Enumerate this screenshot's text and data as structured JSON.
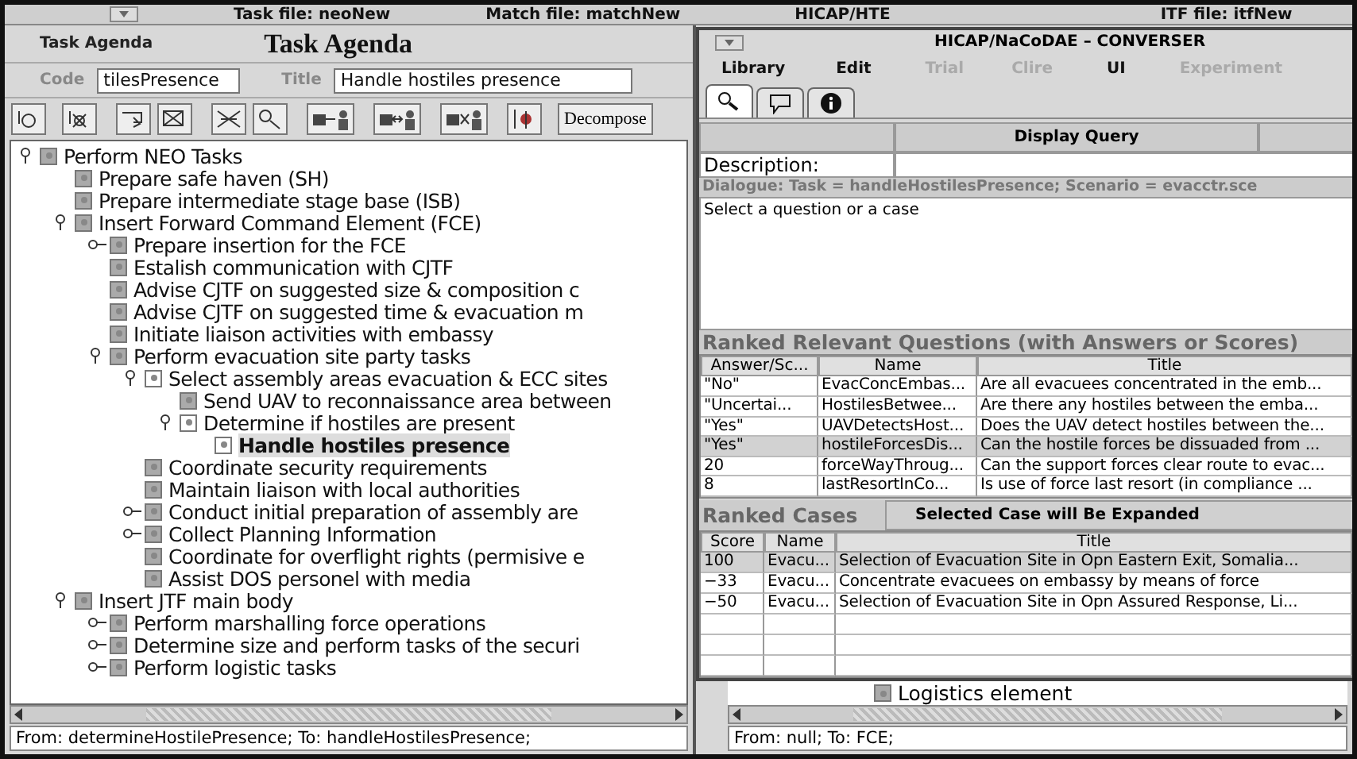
{
  "window": {
    "title_parts": [
      "Task file: neoNew",
      "Match file: matchNew",
      "HICAP/HTE",
      "ITF file: itfNew"
    ]
  },
  "agenda": {
    "label": "Task Agenda",
    "title": "Task Agenda",
    "code_label": "Code",
    "code_value": "tilesPresence",
    "title_label": "Title",
    "title_value": "Handle hostiles presence",
    "decompose": "Decompose",
    "tree": [
      {
        "label": "Perform NEO Tasks",
        "kind": "expanded",
        "hollow": false,
        "selected": false,
        "children": [
          {
            "label": "Prepare safe haven (SH)",
            "kind": "leaf",
            "hollow": false,
            "selected": false
          },
          {
            "label": "Prepare intermediate stage base (ISB)",
            "kind": "leaf",
            "hollow": false,
            "selected": false
          },
          {
            "label": "Insert Forward Command Element (FCE)",
            "kind": "expanded",
            "hollow": false,
            "selected": false,
            "children": [
              {
                "label": "Prepare insertion for the FCE",
                "kind": "collapsed",
                "hollow": false,
                "selected": false
              },
              {
                "label": "Estalish communication with CJTF",
                "kind": "leaf",
                "hollow": false,
                "selected": false
              },
              {
                "label": "Advise CJTF on suggested size & composition c",
                "kind": "leaf",
                "hollow": false,
                "selected": false
              },
              {
                "label": "Advise CJTF on suggested time & evacuation m",
                "kind": "leaf",
                "hollow": false,
                "selected": false
              },
              {
                "label": "Initiate liaison activities with embassy",
                "kind": "leaf",
                "hollow": false,
                "selected": false
              },
              {
                "label": "Perform evacuation site party tasks",
                "kind": "expanded",
                "hollow": false,
                "selected": false,
                "children": [
                  {
                    "label": "Select assembly areas evacuation & ECC sites",
                    "kind": "expanded",
                    "hollow": true,
                    "selected": false,
                    "children": [
                      {
                        "label": "Send UAV to reconnaissance area between",
                        "kind": "leaf",
                        "hollow": false,
                        "selected": false
                      },
                      {
                        "label": "Determine if hostiles are present",
                        "kind": "expanded",
                        "hollow": true,
                        "selected": false,
                        "children": [
                          {
                            "label": "Handle hostiles presence",
                            "kind": "leaf",
                            "hollow": true,
                            "selected": true
                          }
                        ]
                      }
                    ]
                  },
                  {
                    "label": "Coordinate security requirements",
                    "kind": "leaf",
                    "hollow": false,
                    "selected": false
                  },
                  {
                    "label": "Maintain liaison with local authorities",
                    "kind": "leaf",
                    "hollow": false,
                    "selected": false
                  },
                  {
                    "label": "Conduct initial preparation of assembly are",
                    "kind": "collapsed",
                    "hollow": false,
                    "selected": false
                  },
                  {
                    "label": "Collect Planning Information",
                    "kind": "collapsed",
                    "hollow": false,
                    "selected": false
                  },
                  {
                    "label": "Coordinate for overflight rights (permisive e",
                    "kind": "leaf",
                    "hollow": false,
                    "selected": false
                  },
                  {
                    "label": "Assist DOS personel with media",
                    "kind": "leaf",
                    "hollow": false,
                    "selected": false
                  }
                ]
              }
            ]
          },
          {
            "label": "Insert JTF main body",
            "kind": "expanded",
            "hollow": false,
            "selected": false,
            "children": [
              {
                "label": "Perform marshalling force operations",
                "kind": "collapsed",
                "hollow": false,
                "selected": false
              },
              {
                "label": "Determine size and perform tasks of the securi",
                "kind": "collapsed",
                "hollow": false,
                "selected": false
              },
              {
                "label": "Perform logistic tasks",
                "kind": "collapsed",
                "hollow": false,
                "selected": false
              }
            ]
          }
        ]
      }
    ],
    "status": "From: determineHostilePresence; To: handleHostilesPresence;"
  },
  "behind": {
    "tree_row": "Logistics element",
    "status": "From: null; To: FCE;"
  },
  "converser": {
    "title": "HICAP/NaCoDAE  –  CONVERSER",
    "menu": [
      {
        "label": "Library",
        "disabled": false
      },
      {
        "label": "Edit",
        "disabled": false
      },
      {
        "label": "Trial",
        "disabled": true
      },
      {
        "label": "Clire",
        "disabled": true
      },
      {
        "label": "UI",
        "disabled": false
      },
      {
        "label": "Experiment",
        "disabled": true
      }
    ],
    "tabs": [
      {
        "selected": true
      },
      {
        "selected": false
      },
      {
        "selected": false
      }
    ],
    "display_query": "Display Query",
    "description_label": "Description:",
    "dialogue": "Dialogue: Task = handleHostilesPresence; Scenario = evacctr.sce",
    "prompt": "Select a question or a case",
    "questions": {
      "heading": "Ranked Relevant Questions (with Answers or Scores)",
      "columns": [
        "Answer/Sc...",
        "Name",
        "Title"
      ],
      "rows": [
        {
          "cells": [
            "\"No\"",
            "EvacConcEmbas...",
            "Are all evacuees concentrated in the emb..."
          ],
          "selected": false
        },
        {
          "cells": [
            "\"Uncertai...",
            "HostilesBetwee...",
            "Are there any hostiles between the emba..."
          ],
          "selected": false
        },
        {
          "cells": [
            "\"Yes\"",
            "UAVDetectsHost...",
            "Does the UAV detect hostiles between the..."
          ],
          "selected": false
        },
        {
          "cells": [
            "\"Yes\"",
            "hostileForcesDis...",
            "Can the hostile forces be dissuaded from ..."
          ],
          "selected": true
        },
        {
          "cells": [
            "20",
            "forceWayThroug...",
            "Can the support forces clear route to evac..."
          ],
          "selected": false
        },
        {
          "cells": [
            "8",
            "lastResortInCo...",
            "Is use of force last resort (in compliance ..."
          ],
          "selected": false
        }
      ]
    },
    "cases": {
      "heading": "Ranked Cases",
      "button": "Selected Case will Be Expanded",
      "columns": [
        "Score",
        "Name",
        "Title"
      ],
      "rows": [
        {
          "cells": [
            "100",
            "Evacu...",
            "Selection of Evacuation Site in Opn Eastern Exit, Somalia..."
          ],
          "selected": true
        },
        {
          "cells": [
            "−33",
            "Evacu...",
            "Concentrate evacuees on embassy by means of force"
          ],
          "selected": false
        },
        {
          "cells": [
            "−50",
            "Evacu...",
            "Selection of Evacuation Site in Opn Assured Response, Li..."
          ],
          "selected": false
        }
      ]
    }
  }
}
